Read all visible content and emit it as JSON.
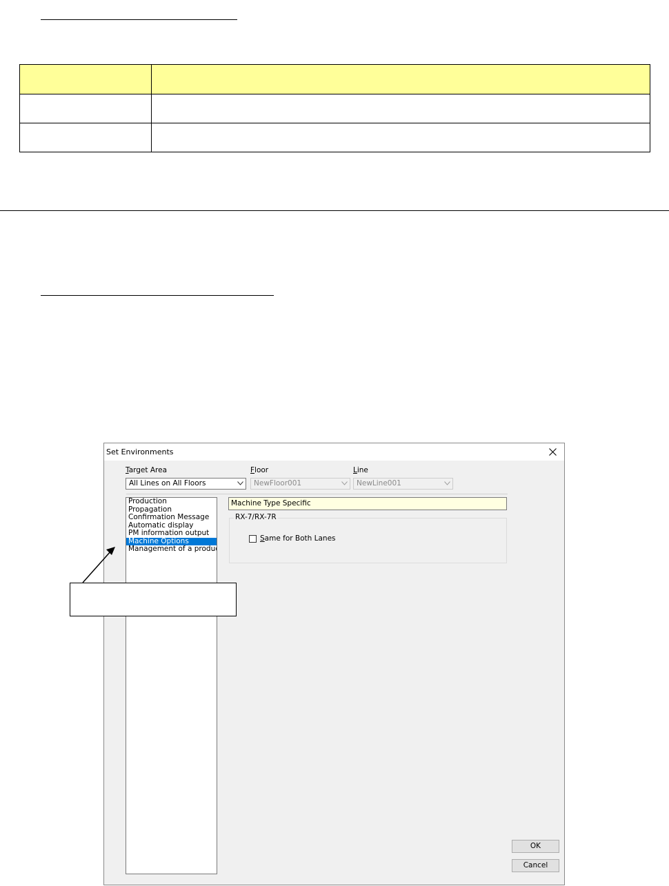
{
  "dialog": {
    "title": "Set Environments",
    "target_area": {
      "label_key": "T",
      "label_rest": "arget Area",
      "value": "All Lines on All Floors"
    },
    "floor": {
      "label_key": "F",
      "label_rest": "loor",
      "value": "NewFloor001"
    },
    "line": {
      "label_key": "L",
      "label_rest": "ine",
      "value": "NewLine001"
    },
    "list_items": [
      "Production",
      "Propagation",
      "Confirmation Message",
      "Automatic display",
      "PM information output",
      "Machine Options",
      "Management of a producti"
    ],
    "selected_item": "Machine Options",
    "category_title": "Machine Type Specific",
    "group_title": "RX-7/RX-7R",
    "checkbox": {
      "label_key": "S",
      "label_rest": "ame for Both Lanes",
      "checked": false
    },
    "ok_label": "OK",
    "cancel_label": "Cancel"
  },
  "colors": {
    "table_header": "#ffff99",
    "selection": "#0078d7",
    "category_bg": "#ffffe1"
  }
}
